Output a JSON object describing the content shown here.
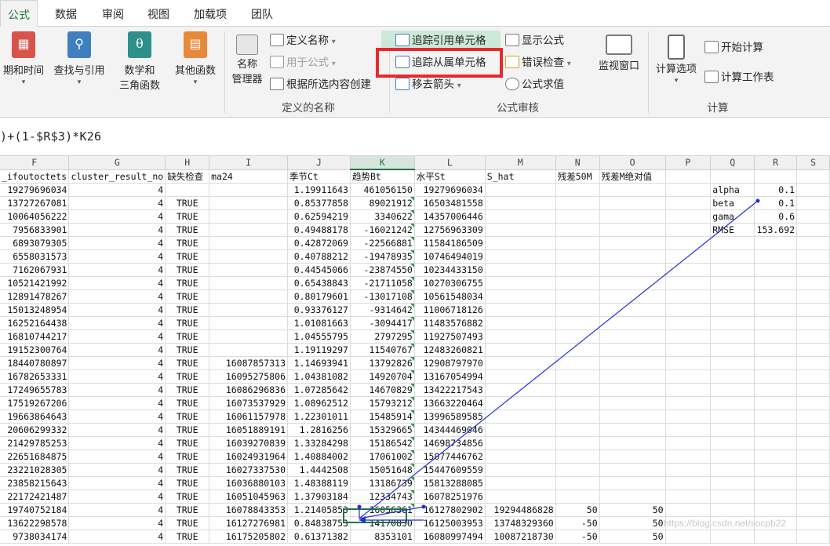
{
  "tabs": [
    "公式",
    "数据",
    "审阅",
    "视图",
    "加载项",
    "团队"
  ],
  "ribbon": {
    "datetime_label": "期和时间",
    "lookup_label": "查找与引用",
    "math_label_1": "数学和",
    "math_label_2": "三角函数",
    "more_label": "其他函数",
    "name_mgr_1": "名称",
    "name_mgr_2": "管理器",
    "define_name": "定义名称",
    "use_in_formula": "用于公式",
    "create_from_sel": "根据所选内容创建",
    "group_names": "定义的名称",
    "trace_precedents": "追踪引用单元格",
    "trace_dependents": "追踪从属单元格",
    "remove_arrows": "移去箭头",
    "show_formulas": "显示公式",
    "error_checking": "错误检查",
    "evaluate_formula": "公式求值",
    "group_audit": "公式审核",
    "watch_window": "监视窗口",
    "calc_options": "计算选项",
    "calc_now": "开始计算",
    "calc_sheet": "计算工作表",
    "group_calc": "计算"
  },
  "formula": ")+(1-$R$3)*K26",
  "columns": [
    "F",
    "G",
    "H",
    "I",
    "J",
    "K",
    "L",
    "M",
    "N",
    "O",
    "P",
    "Q",
    "R",
    "S"
  ],
  "headers": [
    "_ifoutoctets",
    "cluster_result_no",
    "缺失检查",
    "ma24",
    "季节Ct",
    "趋势Bt",
    "水平St",
    "S_hat",
    "残差50M",
    "残差M绝对值",
    "",
    "",
    "",
    ""
  ],
  "rows": [
    [
      "19279696034",
      "4",
      "",
      "",
      "1.19911643",
      "461056150",
      "19279696034",
      "",
      "",
      "",
      "",
      "alpha",
      "0.1",
      ""
    ],
    [
      "13727267081",
      "4",
      "TRUE",
      "",
      "0.85377858",
      "89021912",
      "16503481558",
      "",
      "",
      "",
      "",
      "beta",
      "0.1",
      ""
    ],
    [
      "10064056222",
      "4",
      "TRUE",
      "",
      "0.62594219",
      "3340622",
      "14357006446",
      "",
      "",
      "",
      "",
      "gama",
      "0.6",
      ""
    ],
    [
      "7956833901",
      "4",
      "TRUE",
      "",
      "0.49488178",
      "-16021242",
      "12756963309",
      "",
      "",
      "",
      "",
      "RMSE",
      "153.692",
      ""
    ],
    [
      "6893079305",
      "4",
      "TRUE",
      "",
      "0.42872069",
      "-22566881",
      "11584186509",
      "",
      "",
      "",
      "",
      "",
      "",
      ""
    ],
    [
      "6558031573",
      "4",
      "TRUE",
      "",
      "0.40788212",
      "-19478935",
      "10746494019",
      "",
      "",
      "",
      "",
      "",
      "",
      ""
    ],
    [
      "7162067931",
      "4",
      "TRUE",
      "",
      "0.44545066",
      "-23874550",
      "10234433150",
      "",
      "",
      "",
      "",
      "",
      "",
      ""
    ],
    [
      "10521421992",
      "4",
      "TRUE",
      "",
      "0.65438843",
      "-21711058",
      "10270306755",
      "",
      "",
      "",
      "",
      "",
      "",
      ""
    ],
    [
      "12891478267",
      "4",
      "TRUE",
      "",
      "0.80179601",
      "-13017108",
      "10561548034",
      "",
      "",
      "",
      "",
      "",
      "",
      ""
    ],
    [
      "15013248954",
      "4",
      "TRUE",
      "",
      "0.93376127",
      "-9314642",
      "11006718126",
      "",
      "",
      "",
      "",
      "",
      "",
      ""
    ],
    [
      "16252164438",
      "4",
      "TRUE",
      "",
      "1.01081663",
      "-3094417",
      "11483576882",
      "",
      "",
      "",
      "",
      "",
      "",
      ""
    ],
    [
      "16810744217",
      "4",
      "TRUE",
      "",
      "1.04555795",
      "2797295",
      "11927507493",
      "",
      "",
      "",
      "",
      "",
      "",
      ""
    ],
    [
      "19152300764",
      "4",
      "TRUE",
      "",
      "1.19119297",
      "11540767",
      "12483260821",
      "",
      "",
      "",
      "",
      "",
      "",
      ""
    ],
    [
      "18440780897",
      "4",
      "TRUE",
      "16087857313",
      "1.14693941",
      "13792826",
      "12908797970",
      "",
      "",
      "",
      "",
      "",
      "",
      ""
    ],
    [
      "16782653331",
      "4",
      "TRUE",
      "16095275806",
      "1.04381082",
      "14920704",
      "13167054994",
      "",
      "",
      "",
      "",
      "",
      "",
      ""
    ],
    [
      "17249655783",
      "4",
      "TRUE",
      "16086296836",
      "1.07285642",
      "14670829",
      "13422217543",
      "",
      "",
      "",
      "",
      "",
      "",
      ""
    ],
    [
      "17519267206",
      "4",
      "TRUE",
      "16073537929",
      "1.08962512",
      "15793212",
      "13663220464",
      "",
      "",
      "",
      "",
      "",
      "",
      ""
    ],
    [
      "19663864643",
      "4",
      "TRUE",
      "16061157978",
      "1.22301011",
      "15485914",
      "13996589585",
      "",
      "",
      "",
      "",
      "",
      "",
      ""
    ],
    [
      "20606299332",
      "4",
      "TRUE",
      "16051889191",
      "1.2816256",
      "15329665",
      "14344469046",
      "",
      "",
      "",
      "",
      "",
      "",
      ""
    ],
    [
      "21429785253",
      "4",
      "TRUE",
      "16039270839",
      "1.33284298",
      "15186542",
      "14698734856",
      "",
      "",
      "",
      "",
      "",
      "",
      ""
    ],
    [
      "22651684875",
      "4",
      "TRUE",
      "16024931964",
      "1.40884002",
      "17061002",
      "15077446762",
      "",
      "",
      "",
      "",
      "",
      "",
      ""
    ],
    [
      "23221028305",
      "4",
      "TRUE",
      "16027337530",
      "1.4442508",
      "15051648",
      "15447609559",
      "",
      "",
      "",
      "",
      "",
      "",
      ""
    ],
    [
      "23858215643",
      "4",
      "TRUE",
      "16036880103",
      "1.48388119",
      "13186739",
      "15813288085",
      "",
      "",
      "",
      "",
      "",
      "",
      ""
    ],
    [
      "22172421487",
      "4",
      "TRUE",
      "16051045963",
      "1.37903184",
      "12334743",
      "16078251976",
      "",
      "",
      "",
      "",
      "",
      "",
      ""
    ],
    [
      "19740752184",
      "4",
      "TRUE",
      "16078843353",
      "1.21405853",
      "16056361",
      "16127802902",
      "19294486828",
      "50",
      "50",
      "",
      "",
      "",
      ""
    ],
    [
      "13622298578",
      "4",
      "TRUE",
      "16127276981",
      "0.84838753",
      "14170830",
      "16125003953",
      "13748329360",
      "-50",
      "50",
      "",
      "",
      "",
      ""
    ],
    [
      "9738034174",
      "4",
      "TRUE",
      "16175205802",
      "0.61371382",
      "8353101",
      "16080997494",
      "10087218730",
      "-50",
      "50",
      "",
      "",
      "",
      ""
    ]
  ],
  "watermark": "https://blog.csdn.net/socpb22"
}
